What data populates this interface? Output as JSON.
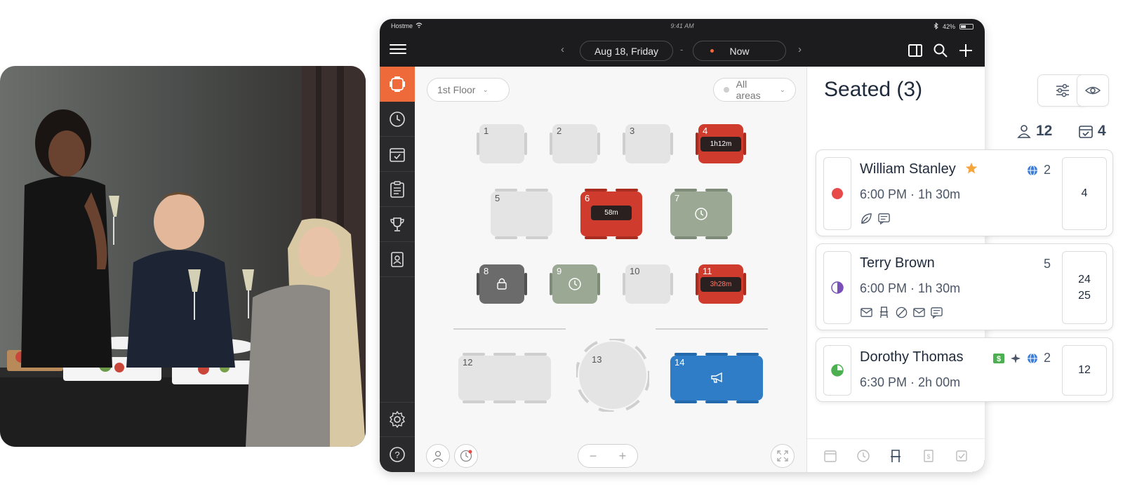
{
  "status_bar": {
    "carrier": "Hostme",
    "time": "9:41 AM",
    "battery": "42%"
  },
  "topbar": {
    "date": "Aug 18, Friday",
    "separator": "-",
    "time_filter": "Now"
  },
  "floor": {
    "floor_select": "1st Floor",
    "area_select": "All areas",
    "tables": [
      {
        "num": "1",
        "status": "free"
      },
      {
        "num": "2",
        "status": "free"
      },
      {
        "num": "3",
        "status": "free"
      },
      {
        "num": "4",
        "status": "seated",
        "timer": "1h12m"
      },
      {
        "num": "5",
        "status": "free"
      },
      {
        "num": "6",
        "status": "seated",
        "timer": "58m"
      },
      {
        "num": "7",
        "status": "upcoming"
      },
      {
        "num": "8",
        "status": "locked"
      },
      {
        "num": "9",
        "status": "upcoming"
      },
      {
        "num": "10",
        "status": "free"
      },
      {
        "num": "11",
        "status": "overdue",
        "timer": "3h28m"
      },
      {
        "num": "12",
        "status": "free"
      },
      {
        "num": "13",
        "status": "free"
      },
      {
        "num": "14",
        "status": "event"
      }
    ],
    "zoom_minus": "−",
    "zoom_plus": "+"
  },
  "panel": {
    "title": "Seated (3)"
  },
  "stats": {
    "guests": "12",
    "reservations": "4"
  },
  "reservations": [
    {
      "name": "William Stanley",
      "time": "6:00 PM · 1h 30m",
      "party": "2",
      "tables": [
        "4"
      ],
      "status_color": "#e84a4a",
      "tags": [
        "leaf-icon",
        "note-icon"
      ]
    },
    {
      "name": "Terry Brown",
      "time": "6:00 PM · 1h 30m",
      "party": "5",
      "tables": [
        "24",
        "25"
      ],
      "status_color": "#7b4fb8",
      "tags": [
        "mail-icon",
        "high-chair-icon",
        "ban-icon",
        "mail-icon",
        "note-icon"
      ]
    },
    {
      "name": "Dorothy Thomas",
      "time": "6:30 PM · 2h 00m",
      "party": "2",
      "tables": [
        "12"
      ],
      "status_color": "#4caf50",
      "tags": []
    }
  ],
  "colors": {
    "accent": "#ee6a3b",
    "seated": "#cf3b2c",
    "upcoming": "#9aa894",
    "event": "#2f7cc7",
    "locked": "#6b6b6b"
  }
}
